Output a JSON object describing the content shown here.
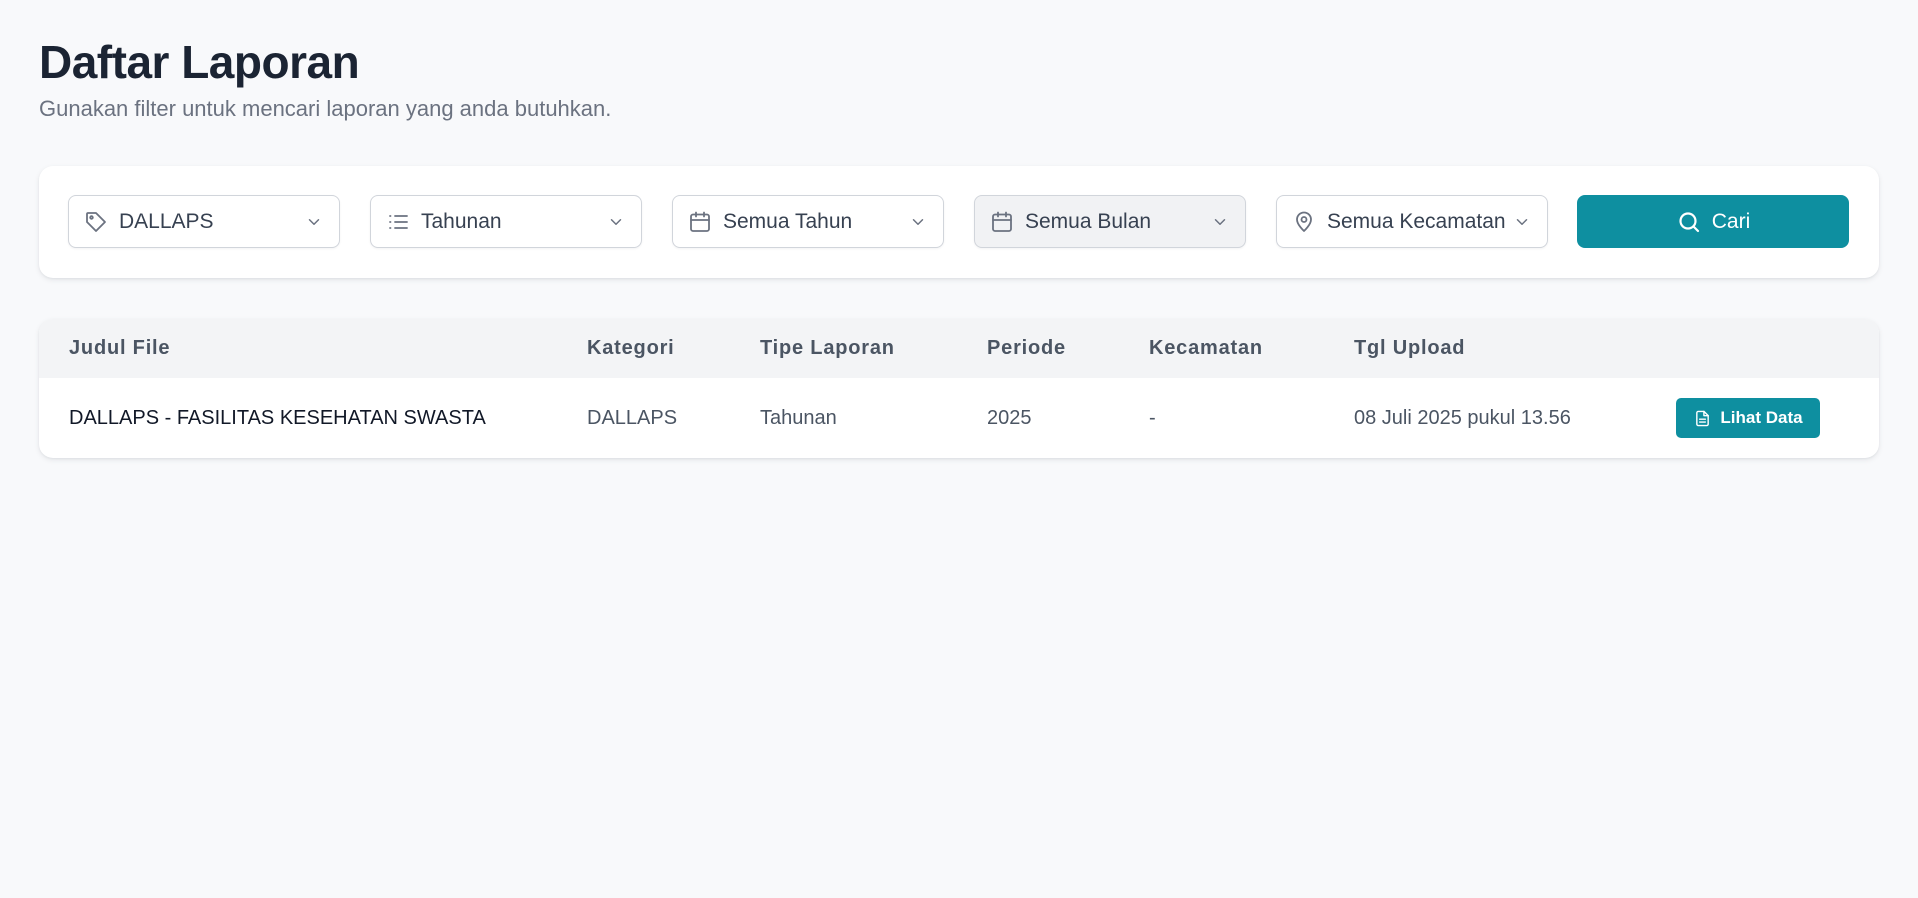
{
  "header": {
    "title": "Daftar Laporan",
    "subtitle": "Gunakan filter untuk mencari laporan yang anda butuhkan."
  },
  "filters": [
    {
      "icon": "tag-icon",
      "value": "DALLAPS"
    },
    {
      "icon": "list-icon",
      "value": "Tahunan"
    },
    {
      "icon": "calendar-icon",
      "value": "Semua Tahun"
    },
    {
      "icon": "calendar-icon",
      "value": "Semua Bulan",
      "disabled": true
    },
    {
      "icon": "map-pin-icon",
      "value": "Semua Kecamatan"
    }
  ],
  "search": {
    "label": "Cari",
    "icon": "search-icon"
  },
  "table": {
    "columns": [
      "Judul File",
      "Kategori",
      "Tipe Laporan",
      "Periode",
      "Kecamatan",
      "Tgl Upload"
    ],
    "rows": [
      {
        "title": "DALLAPS - FASILITAS KESEHATAN SWASTA",
        "category": "DALLAPS",
        "type": "Tahunan",
        "period": "2025",
        "district": "-",
        "uploaded": "08 Juli 2025 pukul 13.56",
        "action_label": "Lihat Data",
        "action_icon": "document-icon"
      }
    ]
  },
  "colors": {
    "accent": "#0e8fa0",
    "background": "#f8f9fb",
    "title": "#1b2433"
  }
}
